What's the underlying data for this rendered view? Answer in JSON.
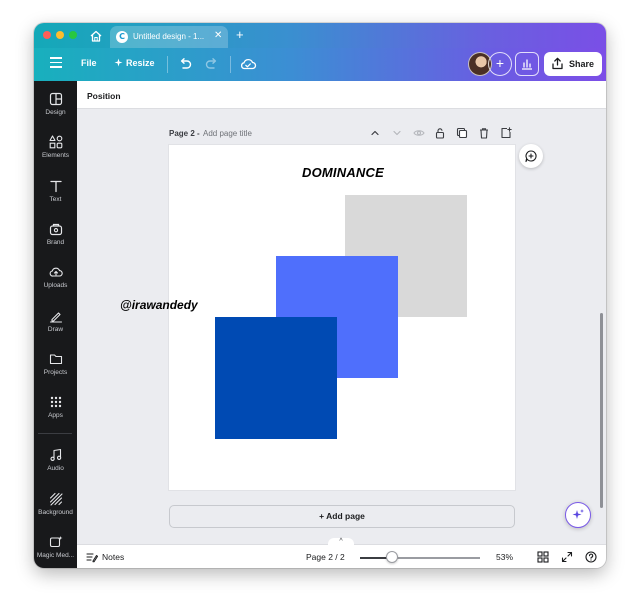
{
  "browser": {
    "tab_title": "Untitled design - 1...",
    "tab_logo": "C",
    "close_glyph": "✕",
    "new_tab_glyph": "+"
  },
  "toolbar": {
    "file_label": "File",
    "resize_label": "Resize",
    "add_collaborator_glyph": "+",
    "share_label": "Share"
  },
  "sidebar": {
    "items": [
      {
        "label": "Design",
        "icon": "design-icon"
      },
      {
        "label": "Elements",
        "icon": "elements-icon"
      },
      {
        "label": "Text",
        "icon": "text-icon"
      },
      {
        "label": "Brand",
        "icon": "brand-icon"
      },
      {
        "label": "Uploads",
        "icon": "uploads-icon"
      },
      {
        "label": "Draw",
        "icon": "draw-icon"
      },
      {
        "label": "Projects",
        "icon": "projects-icon"
      },
      {
        "label": "Apps",
        "icon": "apps-icon"
      },
      {
        "label": "Audio",
        "icon": "audio-icon"
      },
      {
        "label": "Background",
        "icon": "background-icon"
      },
      {
        "label": "Magic Med...",
        "icon": "magic-media-icon"
      }
    ]
  },
  "context": {
    "position_label": "Position"
  },
  "page": {
    "number_label": "Page 2 -",
    "title_placeholder": "Add page title",
    "heading": "DOMINANCE",
    "watermark": "@irawandedy",
    "colors": {
      "light_gray": "#d9d9d9",
      "medium_blue": "#4f6ffc",
      "dark_blue": "#004ab3"
    }
  },
  "add_page_label": "+ Add page",
  "bottom": {
    "collapse_glyph": "^",
    "notes_label": "Notes",
    "page_indicator": "Page 2 / 2",
    "zoom_label": "53%",
    "zoom_percent": 53
  }
}
